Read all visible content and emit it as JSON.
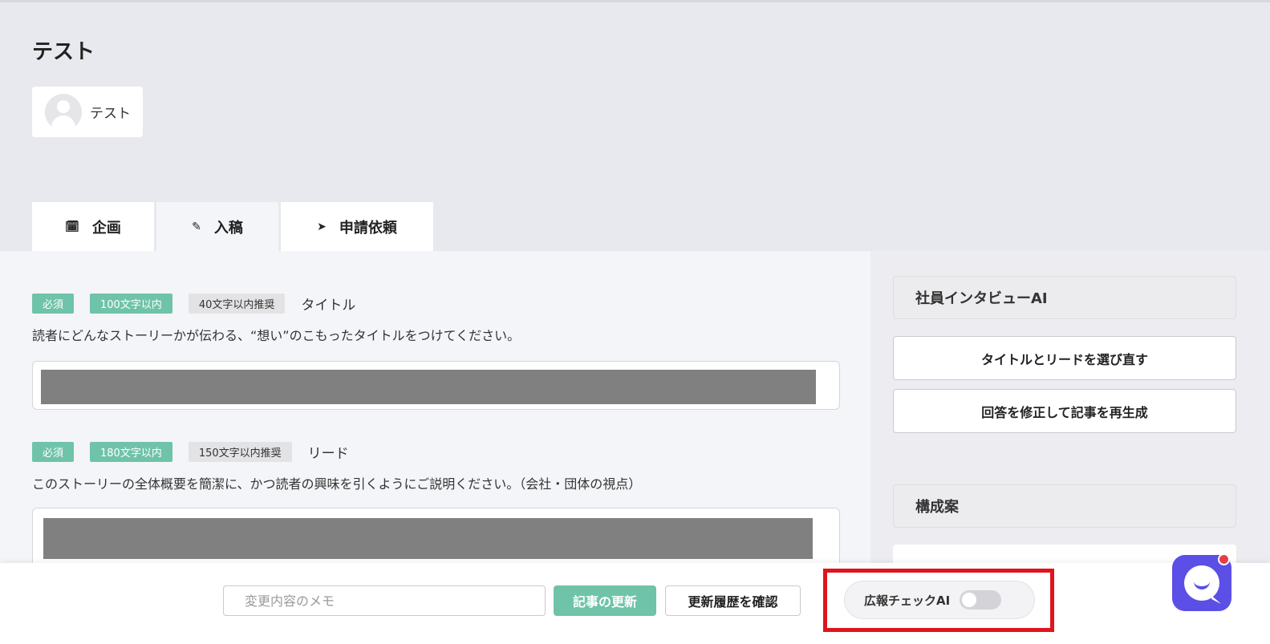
{
  "page": {
    "title": "テスト",
    "author_name": "テスト"
  },
  "tabs": [
    {
      "label": "企画",
      "icon": "calendar-icon",
      "glyph": "🗓"
    },
    {
      "label": "入稿",
      "icon": "pencil-icon",
      "glyph": "✎"
    },
    {
      "label": "申請依頼",
      "icon": "send-icon",
      "glyph": "➤"
    }
  ],
  "fields": {
    "title": {
      "required": "必須",
      "limit": "100文字以内",
      "recommended": "40文字以内推奨",
      "label": "タイトル",
      "description": "読者にどんなストーリーかが伝わる、“想い”のこもったタイトルをつけてください。"
    },
    "lead": {
      "required": "必須",
      "limit": "180文字以内",
      "recommended": "150文字以内推奨",
      "label": "リード",
      "description": "このストーリーの全体概要を簡潔に、かつ読者の興味を引くようにご説明ください。（会社・団体の視点）"
    }
  },
  "sidebar": {
    "interview_header": "社員インタビューAI",
    "reselect_button": "タイトルとリードを選び直す",
    "regenerate_button": "回答を修正して記事を再生成",
    "outline_header": "構成案"
  },
  "bottom_bar": {
    "memo_placeholder": "変更内容のメモ",
    "update_button": "記事の更新",
    "history_button": "更新履歴を確認",
    "pr_check_label": "広報チェックAI",
    "pr_check_enabled": false
  },
  "colors": {
    "accent": "#6fc3a8",
    "highlight": "#e0141e",
    "chat": "#5b4fe6"
  }
}
